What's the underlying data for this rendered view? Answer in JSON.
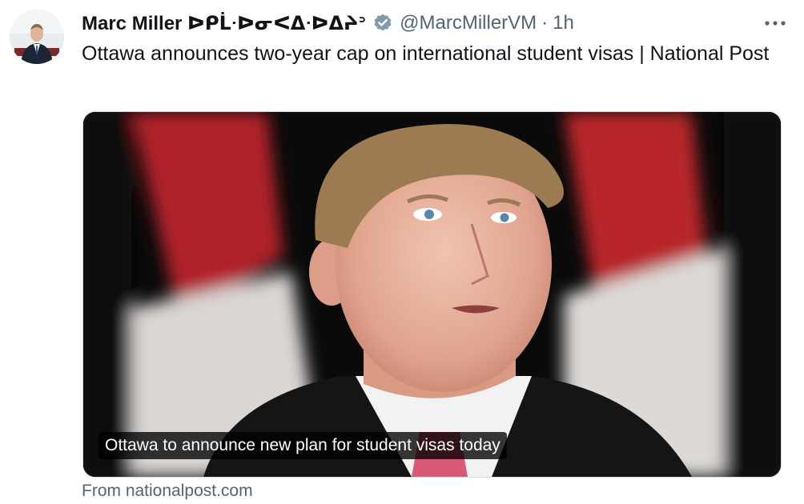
{
  "tweet": {
    "author": {
      "name": "Marc Miller ᐅᑭᒫᐧᐅᓂᐸᐃᐧᐅᐃᔨᐣ",
      "handle": "@MarcMillerVM",
      "verified": true,
      "avatar_icon": "profile-photo"
    },
    "separator": "·",
    "time": "1h",
    "more_icon": "more-horizontal-icon",
    "text": "Ottawa announces two-year cap on international student visas | National Post",
    "card": {
      "caption": "Ottawa to announce new plan for student visas today",
      "source": "From nationalpost.com"
    }
  },
  "colors": {
    "text": "#0f1419",
    "secondary": "#536471",
    "verified_badge": "#829aab",
    "card_border": "#cfd9de",
    "flag_red": "#c8242a"
  }
}
